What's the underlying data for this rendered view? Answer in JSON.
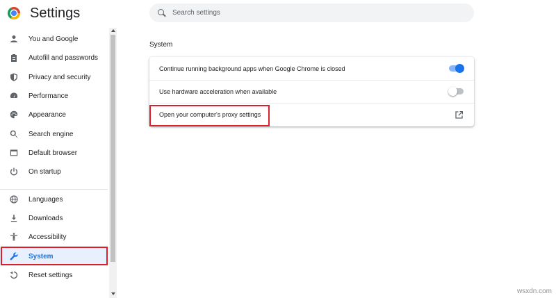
{
  "header": {
    "app_title": "Settings",
    "logo_icon": "chrome-logo-icon"
  },
  "search": {
    "placeholder": "Search settings",
    "value": ""
  },
  "sidebar": {
    "items": [
      {
        "label": "You and Google",
        "icon": "person-icon",
        "active": false
      },
      {
        "label": "Autofill and passwords",
        "icon": "clipboard-icon",
        "active": false
      },
      {
        "label": "Privacy and security",
        "icon": "shield-icon",
        "active": false
      },
      {
        "label": "Performance",
        "icon": "speedometer-icon",
        "active": false
      },
      {
        "label": "Appearance",
        "icon": "palette-icon",
        "active": false
      },
      {
        "label": "Search engine",
        "icon": "search-icon",
        "active": false
      },
      {
        "label": "Default browser",
        "icon": "browser-window-icon",
        "active": false
      },
      {
        "label": "On startup",
        "icon": "power-icon",
        "active": false
      },
      {
        "label": "Languages",
        "icon": "globe-icon",
        "active": false
      },
      {
        "label": "Downloads",
        "icon": "download-icon",
        "active": false
      },
      {
        "label": "Accessibility",
        "icon": "accessibility-icon",
        "active": false
      },
      {
        "label": "System",
        "icon": "wrench-icon",
        "active": true
      },
      {
        "label": "Reset settings",
        "icon": "reset-icon",
        "active": false
      }
    ]
  },
  "main": {
    "section_title": "System",
    "rows": [
      {
        "label": "Continue running background apps when Google Chrome is closed",
        "control": "toggle",
        "state": "on"
      },
      {
        "label": "Use hardware acceleration when available",
        "control": "toggle",
        "state": "off"
      },
      {
        "label": "Open your computer's proxy settings",
        "control": "external-link",
        "icon": "open-in-new-icon"
      }
    ]
  },
  "colors": {
    "accent": "#1a73e8",
    "highlight_box": "#d9202c",
    "active_bg": "#e8f0fe"
  },
  "watermark": "wsxdn.com"
}
